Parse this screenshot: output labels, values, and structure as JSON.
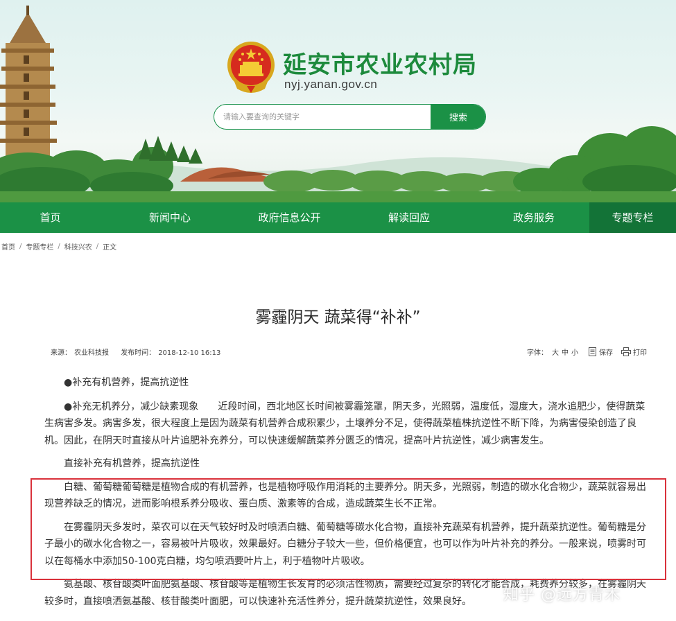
{
  "site": {
    "title": "延安市农业农村局",
    "domain": "nyj.yanan.gov.cn"
  },
  "search": {
    "placeholder": "请输入要查询的关键字",
    "button_label": "搜索"
  },
  "nav": {
    "items": [
      {
        "label": "首页"
      },
      {
        "label": "新闻中心"
      },
      {
        "label": "政府信息公开"
      },
      {
        "label": "解读回应"
      },
      {
        "label": "政务服务"
      },
      {
        "label": "专题专栏"
      }
    ]
  },
  "breadcrumb": {
    "items": [
      "首页",
      "专题专栏",
      "科技兴农",
      "正文"
    ],
    "separator": "/"
  },
  "article": {
    "title": "雾霾阴天 蔬菜得“补补”",
    "source_label": "来源：",
    "source": "农业科技报",
    "publish_label": "发布时间：",
    "publish_time": "2018-12-10 16:13",
    "font_size_label": "字体：",
    "font_sizes": [
      "大",
      "中",
      "小"
    ],
    "save_label": "保存",
    "print_label": "打印",
    "paragraphs": [
      "●补充有机营养，提高抗逆性",
      "●补充无机养分，减少缺素现象　　近段时间，西北地区长时间被雾霾笼罩，阴天多，光照弱，温度低，湿度大，浇水追肥少，使得蔬菜生病害多发。病害多发，很大程度上是因为蔬菜有机营养合成积累少，土壤养分不足，使得蔬菜植株抗逆性不断下降，为病害侵染创造了良机。因此，在阴天时直接从叶片追肥补充养分，可以快速缓解蔬菜养分匮乏的情况，提高叶片抗逆性，减少病害发生。",
      "直接补充有机营养，提高抗逆性",
      "白糖、葡萄糖葡萄糖是植物合成的有机营养，也是植物呼吸作用消耗的主要养分。阴天多，光照弱，制造的碳水化合物少，蔬菜就容易出现营养缺乏的情况，进而影响根系养分吸收、蛋白质、激素等的合成，造成蔬菜生长不正常。",
      "在雾霾阴天多发时，菜农可以在天气较好时及时喷洒白糖、葡萄糖等碳水化合物，直接补充蔬菜有机营养，提升蔬菜抗逆性。葡萄糖是分子最小的碳水化合物之一，容易被叶片吸收，效果最好。白糖分子较大一些，但价格便宜，也可以作为叶片补充的养分。一般来说，喷雾时可以在每桶水中添加50-100克白糖，均匀喷洒要叶片上，利于植物叶片吸收。",
      "氨基酸、核苷酸类叶面肥氨基酸、核苷酸等是植物生长发育的必须活性物质，需要经过复杂的转化才能合成，耗费养分较多，在雾霾阴天较多时，直接喷洒氨基酸、核苷酸类叶面肥，可以快速补充活性养分，提升蔬菜抗逆性，效果良好。"
    ]
  },
  "watermark": "知乎 @远方青木",
  "colors": {
    "brand_green": "#1b9146",
    "nav_active": "#137337",
    "highlight_red": "#d9313b"
  }
}
